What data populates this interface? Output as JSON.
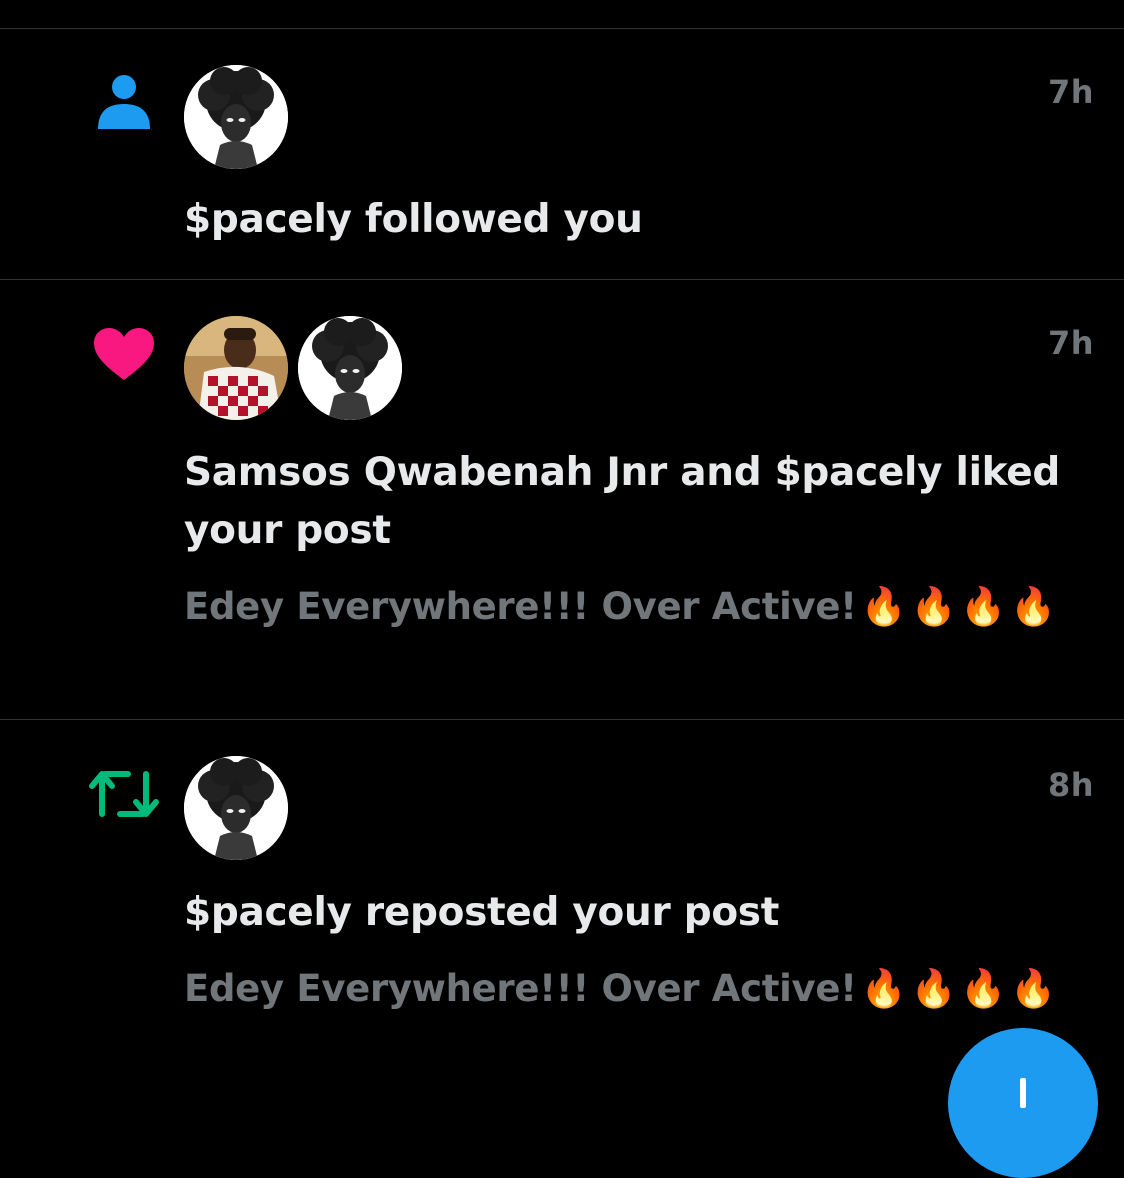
{
  "colors": {
    "background": "#000000",
    "divider": "#2f3336",
    "text_primary": "#e7e9ea",
    "text_secondary": "#71767b",
    "follow_icon": "#1d9bf0",
    "like_icon": "#f91880",
    "repost_icon": "#00ba7c",
    "fab": "#1d9bf0"
  },
  "notifications": [
    {
      "type": "follow",
      "icon": "person-icon",
      "time": "7h",
      "headline": "$pacely followed you",
      "avatars": [
        "spacely-avatar"
      ]
    },
    {
      "type": "like",
      "icon": "heart-icon",
      "time": "7h",
      "headline": "Samsos Qwabenah Jnr and $pacely liked your post",
      "preview": "Edey Everywhere!!! Over Active!",
      "preview_emojis": [
        "🔥",
        "🔥",
        "🔥",
        "🔥"
      ],
      "avatars": [
        "samsos-avatar",
        "spacely-avatar"
      ]
    },
    {
      "type": "repost",
      "icon": "repost-icon",
      "time": "8h",
      "headline": "$pacely reposted your post",
      "preview": "Edey Everywhere!!! Over Active!",
      "preview_emojis": [
        "🔥",
        "🔥",
        "🔥",
        "🔥"
      ],
      "avatars": [
        "spacely-avatar"
      ]
    }
  ],
  "fab": {
    "icon": "compose-icon"
  }
}
